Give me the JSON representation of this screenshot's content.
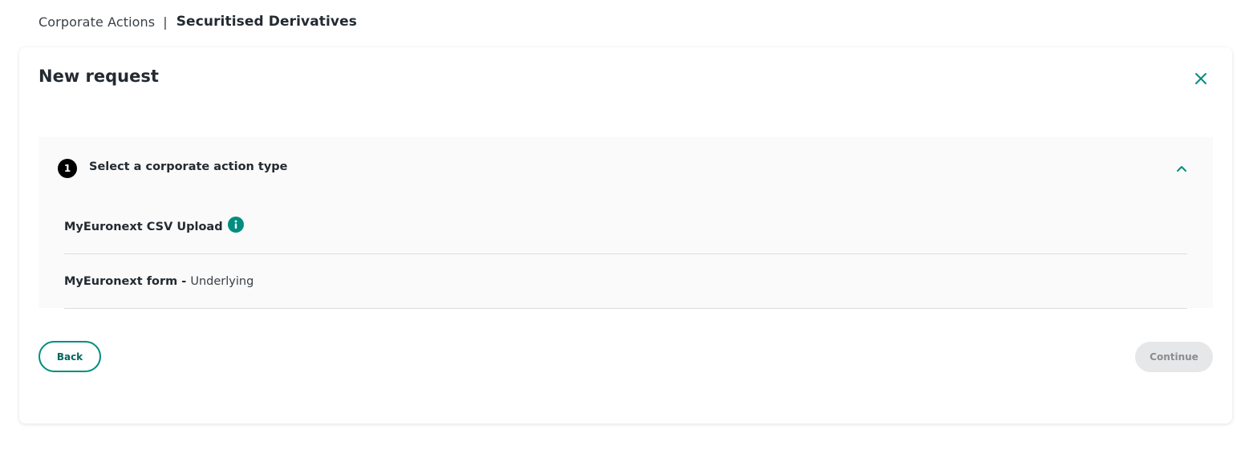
{
  "breadcrumb": {
    "parent": "Corporate Actions",
    "separator": "|",
    "current": "Securitised Derivatives"
  },
  "card": {
    "title": "New request",
    "close_icon": "close-icon"
  },
  "step": {
    "number": "1",
    "title": "Select a corporate action type",
    "expanded": true,
    "toggle_icon": "chevron-up-icon",
    "options": [
      {
        "label": "MyEuronext CSV Upload",
        "suffix": "",
        "icon": "info-icon"
      },
      {
        "label": "MyEuronext form - ",
        "suffix": "Underlying"
      }
    ]
  },
  "actions": {
    "back_label": "Back",
    "continue_label": "Continue",
    "continue_disabled": true
  },
  "colors": {
    "accent": "#008d7f",
    "disabled_bg": "#e6e7e8",
    "disabled_text": "#8a8d90",
    "step_badge": "#000000"
  }
}
